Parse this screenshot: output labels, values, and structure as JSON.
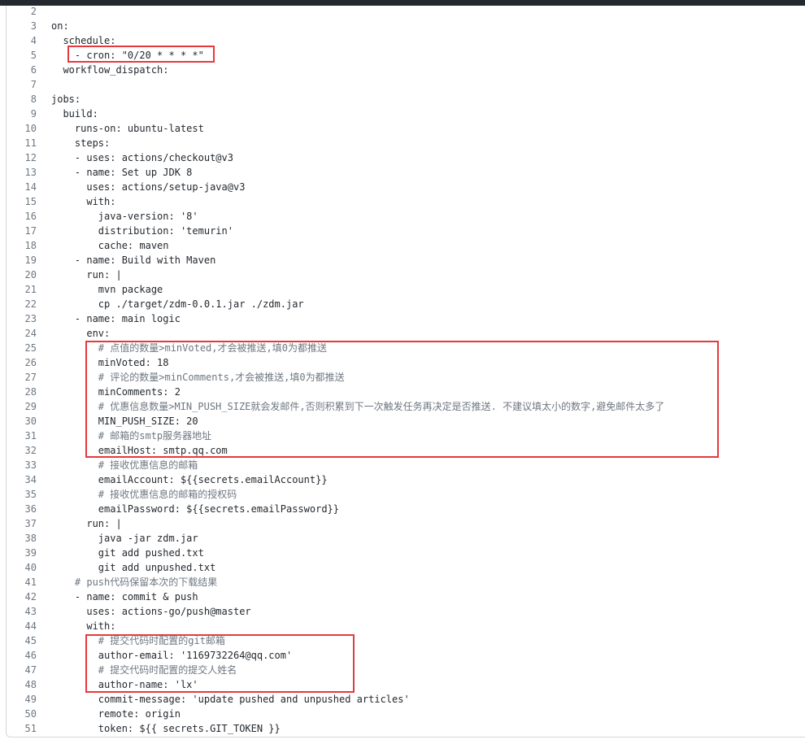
{
  "code_viewer": {
    "lines": [
      {
        "n": "2",
        "text": ""
      },
      {
        "n": "3",
        "text": "on:"
      },
      {
        "n": "4",
        "text": "  schedule:"
      },
      {
        "n": "5",
        "text": "    - cron: \"0/20 * * * *\""
      },
      {
        "n": "6",
        "text": "  workflow_dispatch:"
      },
      {
        "n": "7",
        "text": ""
      },
      {
        "n": "8",
        "text": "jobs:"
      },
      {
        "n": "9",
        "text": "  build:"
      },
      {
        "n": "10",
        "text": "    runs-on: ubuntu-latest"
      },
      {
        "n": "11",
        "text": "    steps:"
      },
      {
        "n": "12",
        "text": "    - uses: actions/checkout@v3"
      },
      {
        "n": "13",
        "text": "    - name: Set up JDK 8"
      },
      {
        "n": "14",
        "text": "      uses: actions/setup-java@v3"
      },
      {
        "n": "15",
        "text": "      with:"
      },
      {
        "n": "16",
        "text": "        java-version: '8'"
      },
      {
        "n": "17",
        "text": "        distribution: 'temurin'"
      },
      {
        "n": "18",
        "text": "        cache: maven"
      },
      {
        "n": "19",
        "text": "    - name: Build with Maven"
      },
      {
        "n": "20",
        "text": "      run: |"
      },
      {
        "n": "21",
        "text": "        mvn package"
      },
      {
        "n": "22",
        "text": "        cp ./target/zdm-0.0.1.jar ./zdm.jar"
      },
      {
        "n": "23",
        "text": "    - name: main logic"
      },
      {
        "n": "24",
        "text": "      env:"
      },
      {
        "n": "25",
        "text": "        # 点值的数量>minVoted,才会被推送,填0为都推送"
      },
      {
        "n": "26",
        "text": "        minVoted: 18"
      },
      {
        "n": "27",
        "text": "        # 评论的数量>minComments,才会被推送,填0为都推送"
      },
      {
        "n": "28",
        "text": "        minComments: 2"
      },
      {
        "n": "29",
        "text": "        # 优惠信息数量>MIN_PUSH_SIZE就会发邮件,否则积累到下一次触发任务再决定是否推送. 不建议填太小的数字,避免邮件太多了"
      },
      {
        "n": "30",
        "text": "        MIN_PUSH_SIZE: 20"
      },
      {
        "n": "31",
        "text": "        # 邮箱的smtp服务器地址"
      },
      {
        "n": "32",
        "text": "        emailHost: smtp.qq.com"
      },
      {
        "n": "33",
        "text": "        # 接收优惠信息的邮箱"
      },
      {
        "n": "34",
        "text": "        emailAccount: ${{secrets.emailAccount}}"
      },
      {
        "n": "35",
        "text": "        # 接收优惠信息的邮箱的授权码"
      },
      {
        "n": "36",
        "text": "        emailPassword: ${{secrets.emailPassword}}"
      },
      {
        "n": "37",
        "text": "      run: |"
      },
      {
        "n": "38",
        "text": "        java -jar zdm.jar"
      },
      {
        "n": "39",
        "text": "        git add pushed.txt"
      },
      {
        "n": "40",
        "text": "        git add unpushed.txt"
      },
      {
        "n": "41",
        "text": "    # push代码保留本次的下载结果"
      },
      {
        "n": "42",
        "text": "    - name: commit & push"
      },
      {
        "n": "43",
        "text": "      uses: actions-go/push@master"
      },
      {
        "n": "44",
        "text": "      with:"
      },
      {
        "n": "45",
        "text": "        # 提交代码时配置的git邮箱"
      },
      {
        "n": "46",
        "text": "        author-email: '1169732264@qq.com'"
      },
      {
        "n": "47",
        "text": "        # 提交代码时配置的提交人姓名"
      },
      {
        "n": "48",
        "text": "        author-name: 'lx'"
      },
      {
        "n": "49",
        "text": "        commit-message: 'update pushed and unpushed articles'"
      },
      {
        "n": "50",
        "text": "        remote: origin"
      },
      {
        "n": "51",
        "text": "        token: ${{ secrets.GIT_TOKEN }}"
      }
    ]
  },
  "colors": {
    "highlight_box": "#e5393d",
    "line_number": "#6e7781",
    "comment": "#6e7781",
    "key": "#116329",
    "string": "#0a3069",
    "number": "#0550ae",
    "top_bar": "#24292f"
  }
}
